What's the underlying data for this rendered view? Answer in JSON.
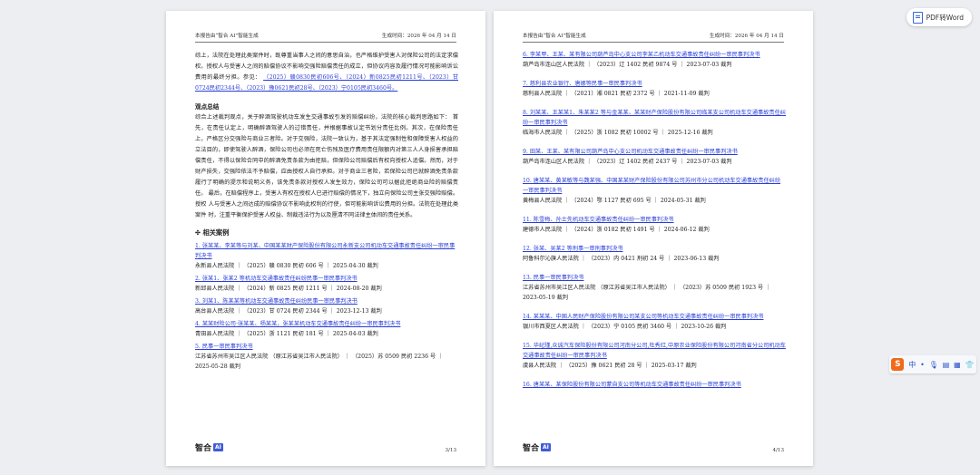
{
  "toolbar": {
    "pdf_to_word": "PDF转Word"
  },
  "header": {
    "left": "本报告由“智合 AI”智能生成",
    "right": "生成时间：2026 年 04 月 14 日"
  },
  "left_page": {
    "intro_lines": [
      "综上，法院在处理此类案件时，既尊重当事人之间的意思自治，也严格维护受害人对保险公司的法定求偿",
      "权。授权人与受害人之间的赔偿协议不影响交强险赔偿责任的成立，但协议内容及履行情况可能影响诉讼",
      "费用的最终分担。参见："
    ],
    "intro_refs": "（2025）赣0830民初606号、（2024）新0825民初1211号、（2023）甘0724民初2344号、（2023）豫0621民初28号、（2023）宁0105民初3460号。",
    "summary_title": "观点总结",
    "summary": [
      "综合上述裁判观点，关于醉酒驾驶机动车发生交通事故引发的赔偿纠纷，法院的核心裁判思路如下：",
      "首先，在责任认定上，明确醉酒驾驶人的过错责任，并根据事故认定书划分责任比例。其次，在保险责任",
      "上，严格区分交强险与商业三者险。对于交强险，法院一致认为，基于其法定强制性和保障受害人权益的",
      "立法目的，即使驾驶人醉酒，保险公司也必须在死亡伤残及医疗费用责任限额内对第三人人身损害承担赔",
      "偿责任，不得以保险合同中的醉酒免责条款为由拒赔，但保险公司赔偿后有权向授权人追偿。然而，对于",
      "财产损失，交强险依法不予赔偿，应由授权人自行承担。对于商业三者险，若保险公司已就醉酒免责条款",
      "履行了明确的提示和说明义务，该免责条款对授权人发生效力，保险公司可以据此拒绝商业险的赔偿责任。",
      "最后，在赔偿程序上，受害人有权在授权人已进行赔偿的情况下，独立向保险公司主张交强险赔偿。授权",
      "人与受害人之间达成的赔偿协议不影响此权利的行使，但可能影响诉讼费用的分担。法院在处理此类案件",
      "时，注重平衡保护受害人权益、制裁违法行为以及厘清不同法律主体间的责任关系。"
    ],
    "cases_title": "相关案例",
    "cases": [
      {
        "title": "1. 张某某、李某等与刘某、中国某某财产保险股份有限公司永新支公司机动车交通事故责任纠纷一审民事判决书",
        "meta": "永新县人民法院 ｜ （2025）赣 0830 民初 606 号 ｜ 2025-04-30 裁判"
      },
      {
        "title": "2. 张某1、张某2 等机动车交通事故责任纠纷民事一审民事判决书",
        "meta": "新邱县人民法院 ｜ （2024）新 0825 民初 1211 号 ｜ 2024-08-20 裁判"
      },
      {
        "title": "3. 刘某1、陈某某等机动车交通事故责任纠纷民事一审民事判决书",
        "meta": "高台县人民法院 ｜ （2023）甘 0724 民初 2344 号 ｜ 2023-12-13 裁判"
      },
      {
        "title": "4. 某某财险公司·张某某、杨某某，张某某机动车交通事故责任纠纷一审民事判决书",
        "meta": "青田县人民法院 ｜ （2025）浙 1121 民初 181 号 ｜ 2025-04-03 裁判"
      },
      {
        "title": "5. 民事一审民事判决书",
        "meta": "江苏省苏州市吴江区人民法院 （原江苏省吴江市人民法院） ｜ （2025）苏 0509 民初 2236 号 ｜ 2025-05-28 裁判"
      }
    ],
    "page_num": "3/13"
  },
  "right_page": {
    "cases": [
      {
        "title": "6. 李某甲、王某、某有限公司葫芦岛中心支公司李某乙机动车交通事故责任纠纷一审民事判决书",
        "meta": "葫芦岛市连山区人民法院 ｜ （2023）辽 1402 民初 9874 号 ｜ 2023-07-03 裁判"
      },
      {
        "title": "7. 慈利县农业银行、唐娜等民事一审民事判决书",
        "meta": "慈利县人民法院 ｜ （2021）湘 0821 民初 2372 号 ｜ 2021-11-09 裁判"
      },
      {
        "title": "8. 刘某某、王某某1、朱某某2 等与金某某、某某财产保险股份有限公司临某支公司机动车交通事故责任纠纷一审民事判决书",
        "meta": "临海市人民法院 ｜ （2025）浙 1082 民初 10002 号 ｜ 2025-12-16 裁判"
      },
      {
        "title": "9. 田某、王某、某有限公司葫芦岛中心支公司机动车交通事故责任纠纷一审民事判决书",
        "meta": "葫芦岛市连山区人民法院 ｜ （2023）辽 1402 民初 2437 号 ｜ 2023-07-03 裁判"
      },
      {
        "title": "10. 唐某某、黄某敏等与魏某强、中国某某财产保险股份有限公司苏州市分公司机动车交通事故责任纠纷一审民事判决书",
        "meta": "黄梅县人民法院 ｜ （2024）鄂 1127 民初 695 号 ｜ 2024-05-31 裁判"
      },
      {
        "title": "11. 陈雪梅、孙士先机动车交通事故责任纠纷一审民事判决书",
        "meta": "建德市人民法院 ｜ （2024）浙 0182 民初 1491 号 ｜ 2024-06-12 裁判"
      },
      {
        "title": "12. 张某、吴某2 等刑事一审刑事判决书",
        "meta": "阿鲁科尔沁旗人民法院 ｜ （2023）内 0421 刑初 24 号 ｜ 2023-06-13 裁判"
      },
      {
        "title": "13. 民事一审民事判决书",
        "meta": "江苏省苏州市吴江区人民法院 （原江苏省吴江市人民法院） ｜ （2023）苏 0509 民初 1923 号 ｜ 2023-05-19 裁判"
      },
      {
        "title": "14. 某某某、中国人民财产保险股份有限公司某支公司等机动车交通事故责任纠纷一审民事判决书",
        "meta": "银川市西夏区人民法院 ｜ （2023）宁 0105 民初 3460 号 ｜ 2023-10-26 裁判"
      },
      {
        "title": "15. 华纪瑾,众诚汽车保险股份有限公司河南分公司,杜秀红,中原农业保险股份有限公司河南省分公司机动车交通事故责任纠纷一审民事判决书",
        "meta": "虞县人民法院 ｜ （2025）豫 0621 民初 28 号 ｜ 2025-03-17 裁判"
      },
      {
        "title": "16. 唐某某、某保险股份有限公司蒙自支公司等机动车交通事故责任纠纷一审民事判决书",
        "meta": ""
      }
    ],
    "page_num": "4/13"
  },
  "footer": {
    "logo_text": "智合",
    "logo_badge": "AI"
  },
  "ime_bar": {
    "lang": "中",
    "punct": "•",
    "extra": "⁜"
  }
}
